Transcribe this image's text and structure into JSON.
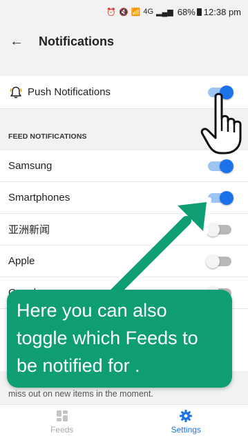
{
  "status_bar": {
    "network": "4G",
    "battery": "68%",
    "time": "12:38 pm"
  },
  "header": {
    "title": "Notifications",
    "back_icon": "arrow-left-icon"
  },
  "push": {
    "label": "Push Notifications",
    "icon": "bell-icon",
    "enabled": true
  },
  "feed_section": {
    "header": "FEED NOTIFICATIONS",
    "items": [
      {
        "label": "Samsung",
        "enabled": true
      },
      {
        "label": "Smartphones",
        "enabled": true
      },
      {
        "label": "亚洲新闻",
        "enabled": false
      },
      {
        "label": "Apple",
        "enabled": false
      },
      {
        "label": "Google",
        "enabled": false
      }
    ]
  },
  "footer_note": "miss out on new items in the moment.",
  "bottom_nav": {
    "items": [
      {
        "label": "Feeds",
        "icon": "feeds-icon",
        "active": false
      },
      {
        "label": "Settings",
        "icon": "gear-icon",
        "active": true
      }
    ]
  },
  "tooltip": {
    "text": "Here you can also toggle which Feeds to be notified for ."
  },
  "colors": {
    "accent": "#1a73e8",
    "tooltip_bg": "#0f9e74",
    "background": "#f2f2f2"
  }
}
